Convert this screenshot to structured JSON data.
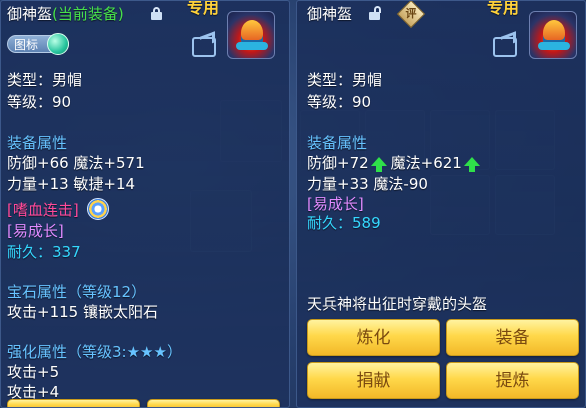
{
  "left": {
    "name": "御神盔",
    "current_tag": "(当前装备)",
    "exclusive": "专用",
    "icon_toggle_label": "图标",
    "type_line": "类型：男帽",
    "level_line": "等级：90",
    "attr_heading": "装备属性",
    "attr_line1": "防御+66 魔法+571",
    "attr_line2": "力量+13 敏捷+14",
    "skill": "[嗜血连击]",
    "growth": "[易成长]",
    "durability_label": "耐久：",
    "durability_value": "337",
    "gem_heading": "宝石属性（等级12）",
    "gem_line": "攻击+115 镶嵌太阳石",
    "enhance_heading": "强化属性（等级3:★★★）",
    "enhance_line1": "攻击+5",
    "enhance_line2": "攻击+4"
  },
  "right": {
    "name": "御神盔",
    "rate_badge": "评",
    "exclusive": "专用",
    "type_line": "类型：男帽",
    "level_line": "等级：90",
    "attr_heading": "装备属性",
    "attr_def": "防御+72",
    "attr_magic": "魔法+621",
    "attr_line2": "力量+33 魔法-90",
    "growth": "[易成长]",
    "durability_label": "耐久：",
    "durability_value": "589",
    "description": "天兵神将出征时穿戴的头盔",
    "btn_refine": "炼化",
    "btn_equip": "装备",
    "btn_donate": "捐献",
    "btn_extract": "提炼"
  },
  "colors": {
    "current_tag": "#47e04a",
    "exclusive": "#ffd23a",
    "heading_blue": "#67c3ff",
    "skill_red": "#ff4a9a",
    "growth_purple": "#e08bff",
    "durability_cyan": "#35d8ff",
    "button_gold": "#ffd84a"
  }
}
